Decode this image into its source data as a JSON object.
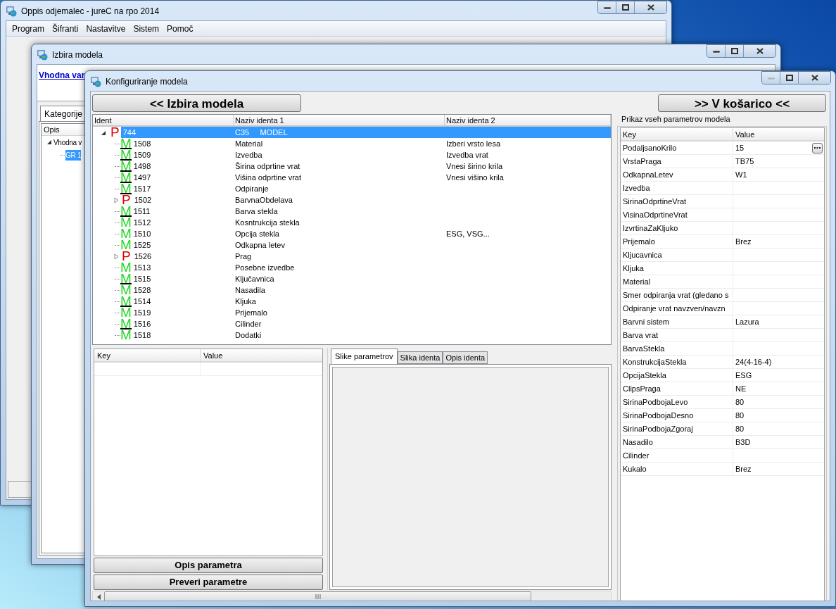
{
  "main_window": {
    "title": "Oppis odjemalec - jureC na rpo 2014",
    "minimize_enabled": true,
    "menu": [
      {
        "label": "Program"
      },
      {
        "label": "Šifranti"
      },
      {
        "label": "Nastavitve"
      },
      {
        "label": "Sistem"
      },
      {
        "label": "Pomoč"
      }
    ]
  },
  "model_window": {
    "title": "Izbira modela",
    "minimize_enabled": true,
    "link": "Vhodna var",
    "tabs": [
      {
        "label": "Kategorije",
        "selected": true
      }
    ],
    "tree": {
      "column": "Opis",
      "items": [
        {
          "label": "Vhodna v",
          "expanded": true,
          "selected": false,
          "children": [
            {
              "label": "GR 1",
              "selected": true
            }
          ]
        }
      ]
    }
  },
  "config_window": {
    "title": "Konfiguriranje modela",
    "minimize_enabled": false,
    "back_button": "<< Izbira modela",
    "cart_button": ">> V košarico <<",
    "tree_table": {
      "columns": [
        "Ident",
        "Naziv identa 1",
        "Naziv identa 2"
      ],
      "rows": [
        {
          "kind": "group",
          "letter": "P",
          "ident": "744",
          "name_1": "C35     MODEL",
          "expanded": true,
          "selected": true,
          "underlined": false,
          "children": [
            {
              "kind": "item",
              "letter": "M",
              "ident": "1508",
              "name_1": "Material",
              "name_2": "Izberi vrsto lesa",
              "selected": false,
              "underlined": true
            },
            {
              "kind": "item",
              "letter": "M",
              "ident": "1509",
              "name_1": "Izvedba",
              "name_2": "Izvedba vrat",
              "selected": false,
              "underlined": true
            },
            {
              "kind": "item",
              "letter": "M",
              "ident": "1498",
              "name_1": "Širina odprtine vrat",
              "name_2": "Vnesi širino krila",
              "selected": false,
              "underlined": true
            },
            {
              "kind": "item",
              "letter": "M",
              "ident": "1497",
              "name_1": "Višina odprtine vrat",
              "name_2": "Vnesi višino krila",
              "selected": false,
              "underlined": true
            },
            {
              "kind": "item",
              "letter": "M",
              "ident": "1517",
              "name_1": "Odpiranje",
              "selected": false,
              "underlined": true
            },
            {
              "kind": "group",
              "letter": "P",
              "ident": "1502",
              "name_1": "BarvnaObdelava",
              "expanded": false,
              "selected": false,
              "underlined": false
            },
            {
              "kind": "item",
              "letter": "M",
              "ident": "1511",
              "name_1": "Barva stekla",
              "selected": false,
              "underlined": true
            },
            {
              "kind": "item",
              "letter": "M",
              "ident": "1512",
              "name_1": "Kosntrukcija stekla",
              "selected": false,
              "underlined": false
            },
            {
              "kind": "item",
              "letter": "M",
              "ident": "1510",
              "name_1": "Opcija stekla",
              "name_2": "ESG, VSG...",
              "selected": false,
              "underlined": false
            },
            {
              "kind": "item",
              "letter": "M",
              "ident": "1525",
              "name_1": "Odkapna letev",
              "selected": false,
              "underlined": false
            },
            {
              "kind": "group",
              "letter": "P",
              "ident": "1526",
              "name_1": "Prag",
              "expanded": false,
              "selected": false,
              "underlined": false
            },
            {
              "kind": "item",
              "letter": "M",
              "ident": "1513",
              "name_1": "Posebne izvedbe",
              "selected": false,
              "underlined": false
            },
            {
              "kind": "item",
              "letter": "M",
              "ident": "1515",
              "name_1": "Ključavnica",
              "selected": false,
              "underlined": true
            },
            {
              "kind": "item",
              "letter": "M",
              "ident": "1528",
              "name_1": "Nasadila",
              "selected": false,
              "underlined": false
            },
            {
              "kind": "item",
              "letter": "M",
              "ident": "1514",
              "name_1": "Kljuka",
              "selected": false,
              "underlined": true
            },
            {
              "kind": "item",
              "letter": "M",
              "ident": "1519",
              "name_1": "Prijemalo",
              "selected": false,
              "underlined": false
            },
            {
              "kind": "item",
              "letter": "M",
              "ident": "1516",
              "name_1": "Cilinder",
              "selected": false,
              "underlined": true
            },
            {
              "kind": "item",
              "letter": "M",
              "ident": "1518",
              "name_1": "Dodatki",
              "selected": false,
              "underlined": false
            }
          ]
        }
      ]
    },
    "parameter_grid": {
      "columns": [
        "Key",
        "Value"
      ]
    },
    "buttons": [
      "Opis parametra",
      "Preveri parametre"
    ],
    "tabs": [
      {
        "label": "Slike parametrov",
        "selected": true
      },
      {
        "label": "Slika identa",
        "selected": false
      },
      {
        "label": "Opis identa",
        "selected": false
      }
    ],
    "all_parameters": {
      "title": "Prikaz vseh parametrov modela",
      "columns": [
        "Key",
        "Value"
      ],
      "rows": [
        {
          "key": "PodaljsanoKrilo",
          "value": "15",
          "has_editor": true
        },
        {
          "key": "VrstaPraga",
          "value": "TB75",
          "has_editor": false
        },
        {
          "key": "OdkapnaLetev",
          "value": "W1",
          "has_editor": false
        },
        {
          "key": "Izvedba",
          "has_editor": false
        },
        {
          "key": "SirinaOdprtineVrat",
          "has_editor": false
        },
        {
          "key": "VisinaOdprtineVrat",
          "has_editor": false
        },
        {
          "key": "IzvrtinaZaKljuko",
          "has_editor": false
        },
        {
          "key": "Prijemalo",
          "value": "Brez",
          "has_editor": false
        },
        {
          "key": "Kljucavnica",
          "has_editor": false
        },
        {
          "key": "Kljuka",
          "has_editor": false
        },
        {
          "key": "Material",
          "has_editor": false
        },
        {
          "key": "Smer odpiranja vrat (gledano s",
          "has_editor": false
        },
        {
          "key": "Odpiranje vrat navzven/navzn",
          "has_editor": false
        },
        {
          "key": "Barvni sistem",
          "value": "Lazura",
          "has_editor": false
        },
        {
          "key": "Barva vrat",
          "has_editor": false
        },
        {
          "key": "BarvaStekla",
          "has_editor": false
        },
        {
          "key": "KonstrukcijaStekla",
          "value": "24(4-16-4)",
          "has_editor": false
        },
        {
          "key": "OpcijaStekla",
          "value": "ESG",
          "has_editor": false
        },
        {
          "key": "ClipsPraga",
          "value": "NE",
          "has_editor": false
        },
        {
          "key": "SirinaPodbojaLevo",
          "value": "80",
          "has_editor": false
        },
        {
          "key": "SirinaPodbojaDesno",
          "value": "80",
          "has_editor": false
        },
        {
          "key": "SirinaPodbojaZgoraj",
          "value": "80",
          "has_editor": false
        },
        {
          "key": "Nasadilo",
          "value": "B3D",
          "has_editor": false
        },
        {
          "key": "Cilinder",
          "has_editor": false
        },
        {
          "key": "Kukalo",
          "value": "Brez",
          "has_editor": false
        }
      ]
    }
  }
}
